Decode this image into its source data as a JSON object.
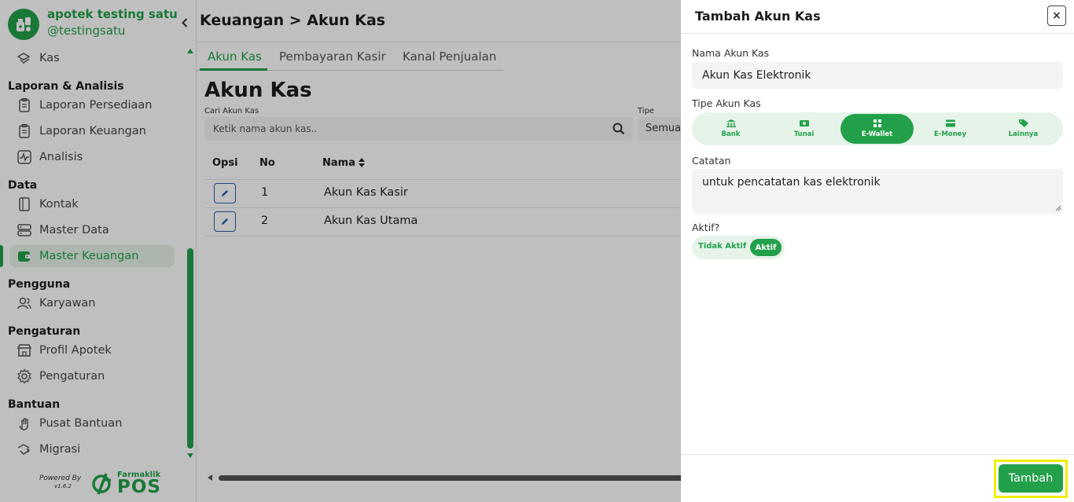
{
  "app": {
    "store_name": "apotek testing satu",
    "store_handle": "@testingsatu"
  },
  "sidebar": {
    "collapse_icon": "chevron-left-icon",
    "items": [
      {
        "type": "item",
        "label": "Kas",
        "icon": "cash-icon"
      },
      {
        "type": "section",
        "label": "Laporan & Analisis"
      },
      {
        "type": "item",
        "label": "Laporan Persediaan",
        "icon": "clipboard-icon"
      },
      {
        "type": "item",
        "label": "Laporan Keuangan",
        "icon": "clipboard-icon"
      },
      {
        "type": "item",
        "label": "Analisis",
        "icon": "activity-icon"
      },
      {
        "type": "section",
        "label": "Data"
      },
      {
        "type": "item",
        "label": "Kontak",
        "icon": "contact-book-icon"
      },
      {
        "type": "item",
        "label": "Master Data",
        "icon": "database-icon"
      },
      {
        "type": "item",
        "label": "Master Keuangan",
        "icon": "wallet-icon",
        "active": true
      },
      {
        "type": "section",
        "label": "Pengguna"
      },
      {
        "type": "item",
        "label": "Karyawan",
        "icon": "users-icon"
      },
      {
        "type": "section",
        "label": "Pengaturan"
      },
      {
        "type": "item",
        "label": "Profil Apotek",
        "icon": "store-icon"
      },
      {
        "type": "item",
        "label": "Pengaturan",
        "icon": "gear-icon"
      },
      {
        "type": "section",
        "label": "Bantuan"
      },
      {
        "type": "item",
        "label": "Pusat Bantuan",
        "icon": "hand-icon"
      },
      {
        "type": "item",
        "label": "Migrasi",
        "icon": "migrate-icon"
      }
    ],
    "footer": {
      "powered_by": "Powered By",
      "version": "v1.6.2",
      "brand_name": "Farmaklik",
      "brand_product": "POS"
    }
  },
  "main": {
    "breadcrumb": "Keuangan > Akun Kas",
    "tabs": [
      {
        "label": "Akun Kas",
        "active": true
      },
      {
        "label": "Pembayaran Kasir",
        "active": false
      },
      {
        "label": "Kanal Penjualan",
        "active": false
      }
    ],
    "title": "Akun Kas",
    "search": {
      "label": "Cari Akun Kas",
      "placeholder": "Ketik nama akun kas.."
    },
    "filter": {
      "label": "Tipe",
      "value": "Semua"
    },
    "table": {
      "columns": [
        "Opsi",
        "No",
        "Nama"
      ],
      "rows": [
        {
          "no": "1",
          "name": "Akun Kas Kasir"
        },
        {
          "no": "2",
          "name": "Akun Kas Utama"
        }
      ]
    }
  },
  "modal": {
    "title": "Tambah Akun Kas",
    "close_label": "×",
    "name_label": "Nama Akun Kas",
    "name_value": "Akun Kas Elektronik",
    "type_label": "Tipe Akun Kas",
    "types": [
      {
        "label": "Bank",
        "icon": "bank-icon",
        "selected": false
      },
      {
        "label": "Tunai",
        "icon": "cash-note-icon",
        "selected": false
      },
      {
        "label": "E-Wallet",
        "icon": "grid-icon",
        "selected": true
      },
      {
        "label": "E-Money",
        "icon": "card-icon",
        "selected": false
      },
      {
        "label": "Lainnya",
        "icon": "tag-icon",
        "selected": false
      }
    ],
    "notes_label": "Catatan",
    "notes_value": "untuk pencatatan kas elektronik",
    "active_label": "Aktif?",
    "toggle_off_label": "Tidak Aktif",
    "toggle_on_label": "Aktif",
    "submit_label": "Tambah"
  },
  "colors": {
    "accent": "#23a04a",
    "accent_light": "#e6f3e9",
    "highlight": "#f2ec00",
    "edit_blue": "#2a5da8"
  }
}
